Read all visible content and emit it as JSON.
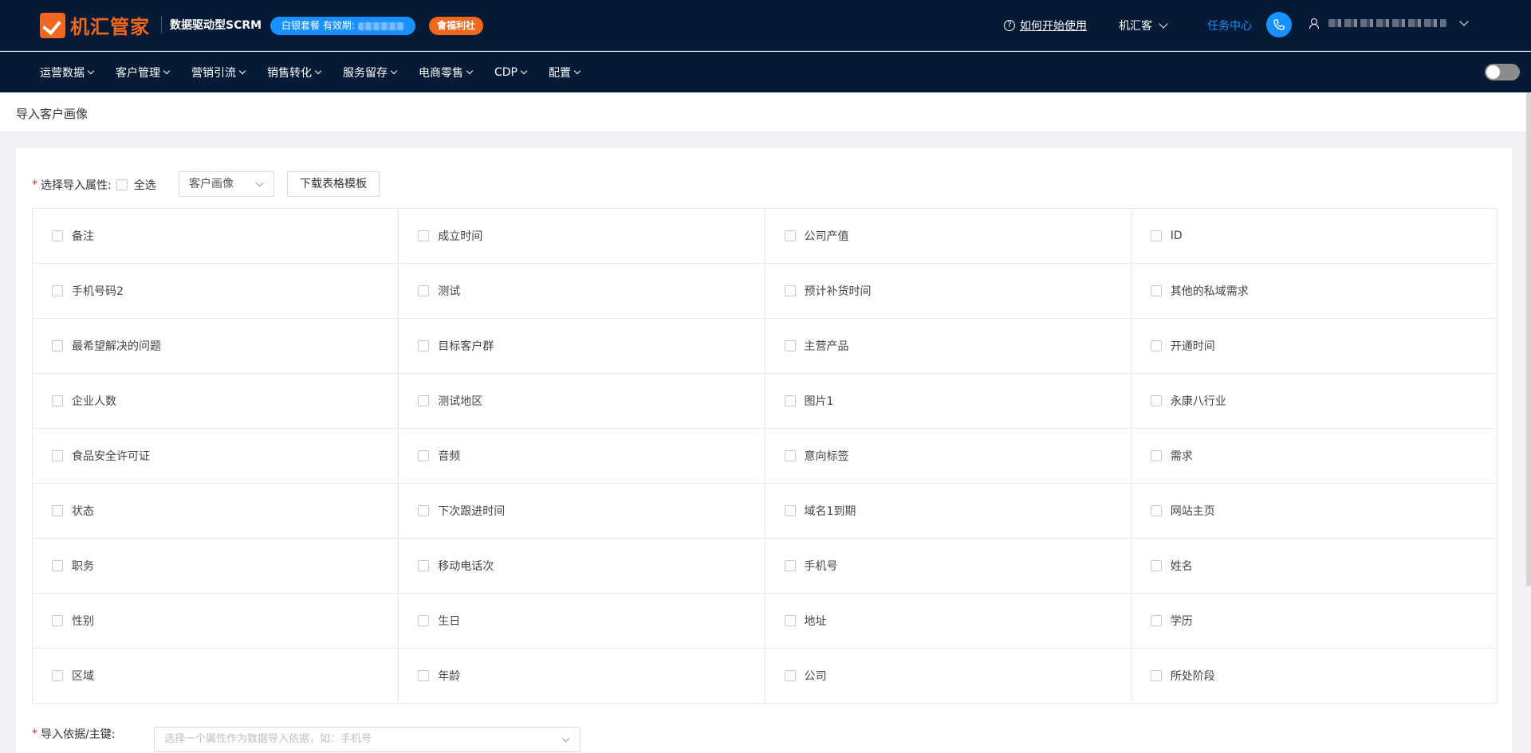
{
  "header": {
    "logo_text": "机汇管家",
    "slogan": "数据驱动型SCRM",
    "plan_badge": "白银套餐 有效期:",
    "welfare_badge": "會福利社",
    "help_link": "如何开始使用",
    "org_name": "机汇客",
    "task_center": "任务中心"
  },
  "nav": [
    {
      "label": "运营数据"
    },
    {
      "label": "客户管理"
    },
    {
      "label": "营销引流"
    },
    {
      "label": "销售转化"
    },
    {
      "label": "服务留存"
    },
    {
      "label": "电商零售"
    },
    {
      "label": "CDP"
    },
    {
      "label": "配置"
    }
  ],
  "page": {
    "title": "导入客户画像"
  },
  "form": {
    "attr_label": "选择导入属性:",
    "select_all": "全选",
    "type_select": "客户画像",
    "download_button": "下载表格模板",
    "attributes": [
      "备注",
      "成立时间",
      "公司产值",
      "ID",
      "手机号码2",
      "测试",
      "预计补货时间",
      "其他的私域需求",
      "最希望解决的问题",
      "目标客户群",
      "主营产品",
      "开通时间",
      "企业人数",
      "测试地区",
      "图片1",
      "永康八行业",
      "食品安全许可证",
      "音频",
      "意向标签",
      "需求",
      "状态",
      "下次跟进时间",
      "域名1到期",
      "网站主页",
      "职务",
      "移动电话次",
      "手机号",
      "姓名",
      "性别",
      "生日",
      "地址",
      "学历",
      "区域",
      "年龄",
      "公司",
      "所处阶段"
    ],
    "key_label": "导入依据/主键:",
    "key_placeholder": "选择一个属性作为数据导入依据，如：手机号"
  },
  "colors": {
    "header_bg": "#041a35",
    "brand_orange": "#f1671e",
    "accent_blue": "#1890ff"
  }
}
